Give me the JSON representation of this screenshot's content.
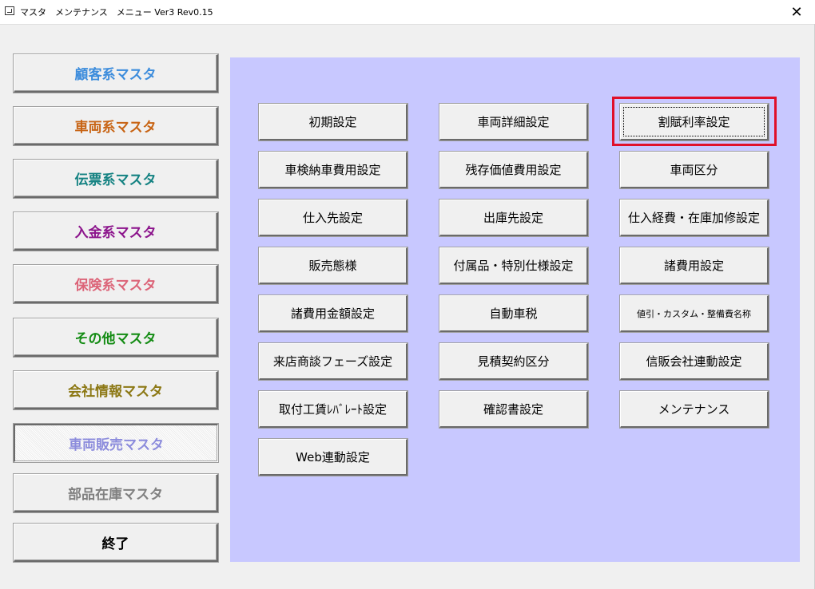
{
  "window": {
    "title": "マスタ　メンテナンス　メニュー Ver3 Rev0.15",
    "close_label": "✕"
  },
  "menu": [
    {
      "label": "顧客系マスタ",
      "color": "#3c8cdc"
    },
    {
      "label": "車両系マスタ",
      "color": "#c86414"
    },
    {
      "label": "伝票系マスタ",
      "color": "#148282"
    },
    {
      "label": "入金系マスタ",
      "color": "#8c148c"
    },
    {
      "label": "保険系マスタ",
      "color": "#dc6478"
    },
    {
      "label": "その他マスタ",
      "color": "#148c14"
    },
    {
      "label": "会社情報マスタ",
      "color": "#8c7814"
    },
    {
      "label": "車両販売マスタ",
      "color": "#8c8cdc",
      "active": true
    },
    {
      "label": "部品在庫マスタ",
      "color": "#808080"
    },
    {
      "label": "終了",
      "color": "#000000"
    }
  ],
  "panel": {
    "background": "#c8c8ff",
    "buttons": [
      [
        "初期設定",
        "車両詳細設定",
        "割賦利率設定"
      ],
      [
        "車検納車費用設定",
        "残存価値費用設定",
        "車両区分"
      ],
      [
        "仕入先設定",
        "出庫先設定",
        "仕入経費・在庫加修設定"
      ],
      [
        "販売態様",
        "付属品・特別仕様設定",
        "諸費用設定"
      ],
      [
        "諸費用金額設定",
        "自動車税",
        "値引・カスタム・整備費名称"
      ],
      [
        "来店商談フェーズ設定",
        "見積契約区分",
        "信販会社連動設定"
      ],
      [
        "取付工賃ﾚﾊﾞﾚｰﾄ設定",
        "確認書設定",
        "メンテナンス"
      ],
      [
        "Web連動設定"
      ]
    ]
  },
  "highlight_color": "#e0102a"
}
